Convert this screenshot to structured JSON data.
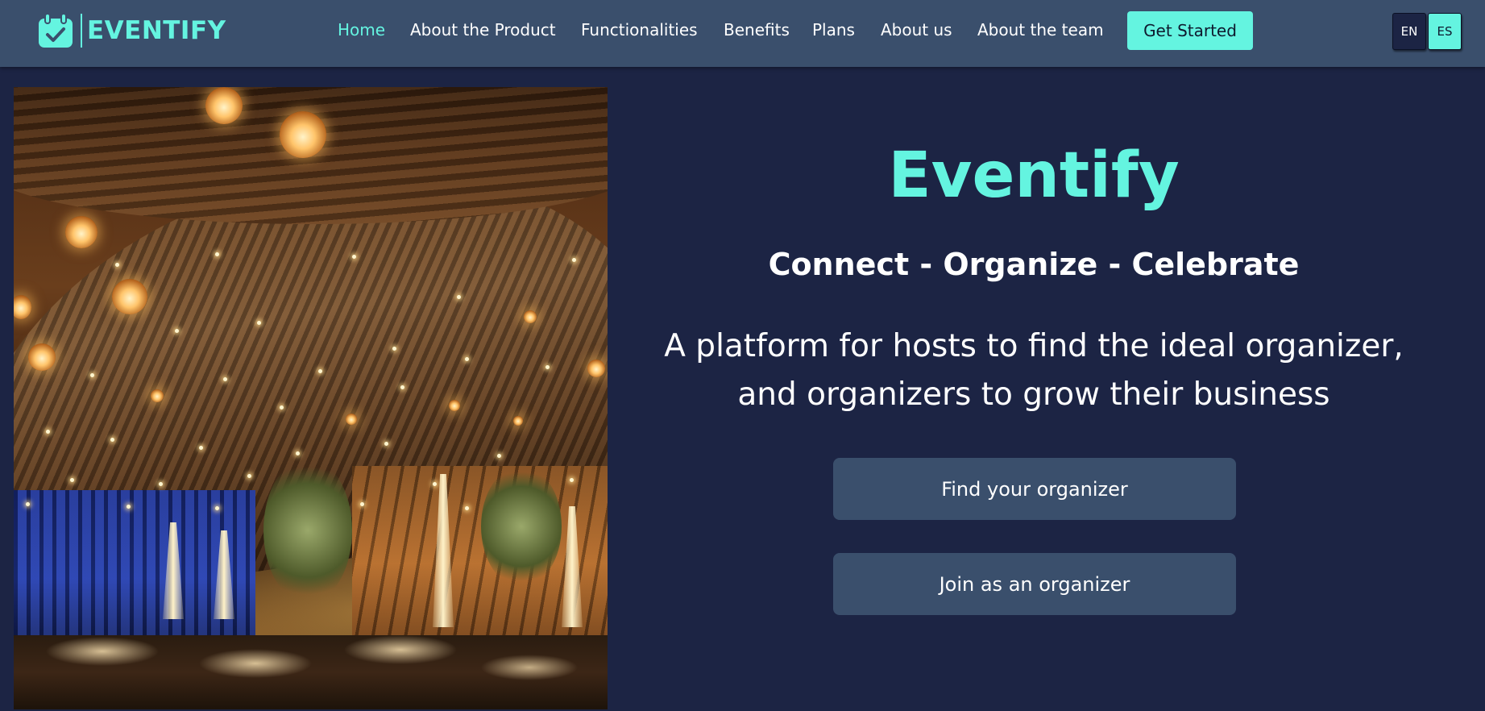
{
  "brand": {
    "name": "EVENTIFY",
    "logo_icon": "calendar-check-icon"
  },
  "nav": {
    "items": [
      {
        "label": "Home",
        "active": true
      },
      {
        "label": "About the Product",
        "active": false
      },
      {
        "label": "Functionalities",
        "active": false
      },
      {
        "label": "Benefits",
        "active": false
      },
      {
        "label": "Plans",
        "active": false
      },
      {
        "label": "About us",
        "active": false
      },
      {
        "label": "About the team",
        "active": false
      }
    ],
    "cta_label": "Get Started"
  },
  "language": {
    "options": [
      "EN",
      "ES"
    ],
    "selected": "ES"
  },
  "hero": {
    "image_description": "event-venue-photo",
    "title": "Eventify",
    "tagline": "Connect - Organize - Celebrate",
    "description_line1": "A platform for hosts to find the ideal organizer,",
    "description_line2": "and organizers to grow their business",
    "buttons": {
      "find": "Find your organizer",
      "join": "Join as an organizer"
    }
  },
  "colors": {
    "background": "#1c2444",
    "navbar": "#3a4f6c",
    "accent": "#64f4e0",
    "button": "#3a4f6c",
    "text": "#ffffff"
  }
}
